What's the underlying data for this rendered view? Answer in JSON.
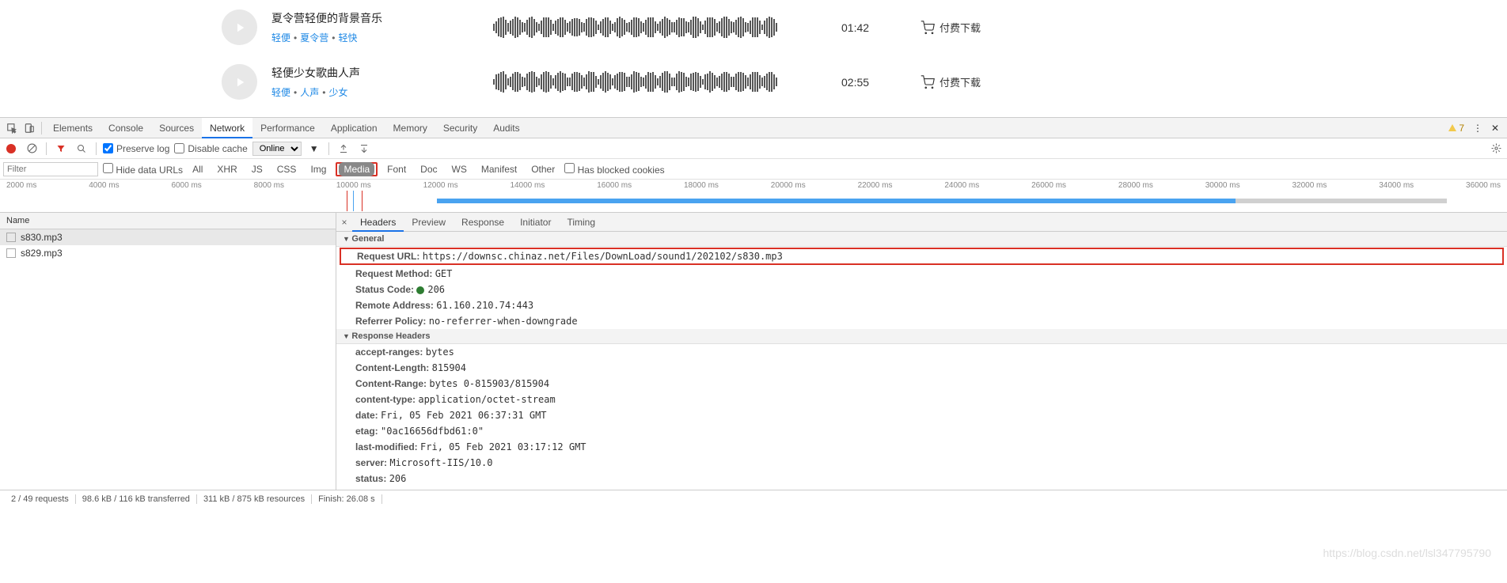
{
  "tracks": [
    {
      "title": "夏令营轻便的背景音乐",
      "tags": [
        "轻便",
        "夏令营",
        "轻快"
      ],
      "duration": "01:42",
      "download": "付费下载"
    },
    {
      "title": "轻便少女歌曲人声",
      "tags": [
        "轻便",
        "人声",
        "少女"
      ],
      "duration": "02:55",
      "download": "付费下载"
    }
  ],
  "devtools_tabs": [
    "Elements",
    "Console",
    "Sources",
    "Network",
    "Performance",
    "Application",
    "Memory",
    "Security",
    "Audits"
  ],
  "devtools_active_tab": "Network",
  "warnings_count": "7",
  "net_toolbar": {
    "preserve_log": "Preserve log",
    "disable_cache": "Disable cache",
    "online": "Online"
  },
  "filter": {
    "placeholder": "Filter",
    "hide_data_urls": "Hide data URLs",
    "types": [
      "All",
      "XHR",
      "JS",
      "CSS",
      "Img",
      "Media",
      "Font",
      "Doc",
      "WS",
      "Manifest",
      "Other"
    ],
    "active_type": "Media",
    "has_blocked": "Has blocked cookies"
  },
  "timeline_ticks": [
    "2000 ms",
    "4000 ms",
    "6000 ms",
    "8000 ms",
    "10000 ms",
    "12000 ms",
    "14000 ms",
    "16000 ms",
    "18000 ms",
    "20000 ms",
    "22000 ms",
    "24000 ms",
    "26000 ms",
    "28000 ms",
    "30000 ms",
    "32000 ms",
    "34000 ms",
    "36000 ms"
  ],
  "req_list_header": "Name",
  "requests": [
    "s830.mp3",
    "s829.mp3"
  ],
  "detail_tabs": [
    "Headers",
    "Preview",
    "Response",
    "Initiator",
    "Timing"
  ],
  "detail_active_tab": "Headers",
  "sections": {
    "general": "General",
    "response_headers": "Response Headers"
  },
  "general": {
    "request_url_label": "Request URL:",
    "request_url": "https://downsc.chinaz.net/Files/DownLoad/sound1/202102/s830.mp3",
    "request_method_label": "Request Method:",
    "request_method": "GET",
    "status_code_label": "Status Code:",
    "status_code": "206",
    "remote_address_label": "Remote Address:",
    "remote_address": "61.160.210.74:443",
    "referrer_policy_label": "Referrer Policy:",
    "referrer_policy": "no-referrer-when-downgrade"
  },
  "response_headers": {
    "accept-ranges": "bytes",
    "Content-Length": "815904",
    "Content-Range": "bytes 0-815903/815904",
    "content-type": "application/octet-stream",
    "date": "Fri, 05 Feb 2021 06:37:31 GMT",
    "etag": "\"0ac16656dfbd61:0\"",
    "last-modified": "Fri, 05 Feb 2021 03:17:12 GMT",
    "server": "Microsoft-IIS/10.0",
    "status": "206"
  },
  "status_bar": {
    "requests": "2 / 49 requests",
    "transferred": "98.6 kB / 116 kB transferred",
    "resources": "311 kB / 875 kB resources",
    "finish": "Finish: 26.08 s"
  },
  "watermark": "https://blog.csdn.net/lsl347795790"
}
